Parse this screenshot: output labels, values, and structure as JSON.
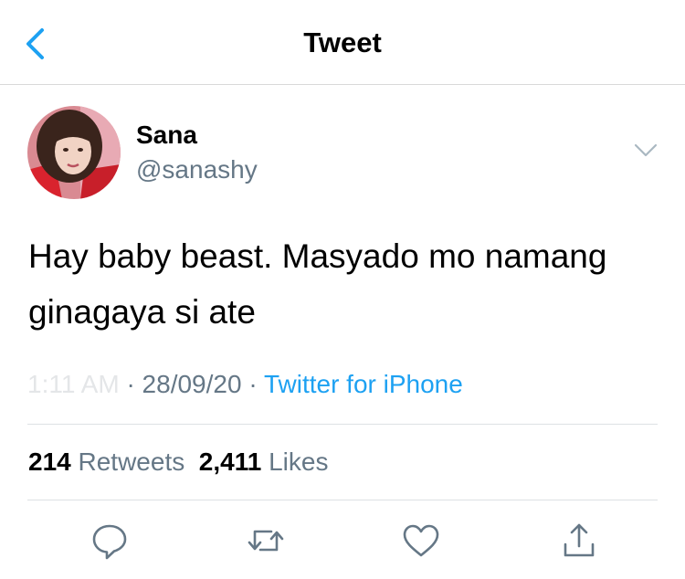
{
  "nav": {
    "title": "Tweet",
    "back_icon": "chevron-left-icon"
  },
  "author": {
    "display_name": "Sana",
    "handle": "@sanashy"
  },
  "tweet": {
    "text": "Hay baby beast. Masyado mo namang ginagaya si ate"
  },
  "meta": {
    "time_obscured": "1:11 AM",
    "separator": "·",
    "date": "28/09/20",
    "source": "Twitter for iPhone"
  },
  "stats": {
    "retweets_count": "214",
    "retweets_label": "Retweets",
    "likes_count": "2,411",
    "likes_label": "Likes"
  },
  "actions": [
    "reply-icon",
    "retweet-icon",
    "like-icon",
    "share-icon"
  ],
  "colors": {
    "accent": "#1da1f2",
    "secondary_text": "#657786",
    "divider": "#dde1e4"
  }
}
